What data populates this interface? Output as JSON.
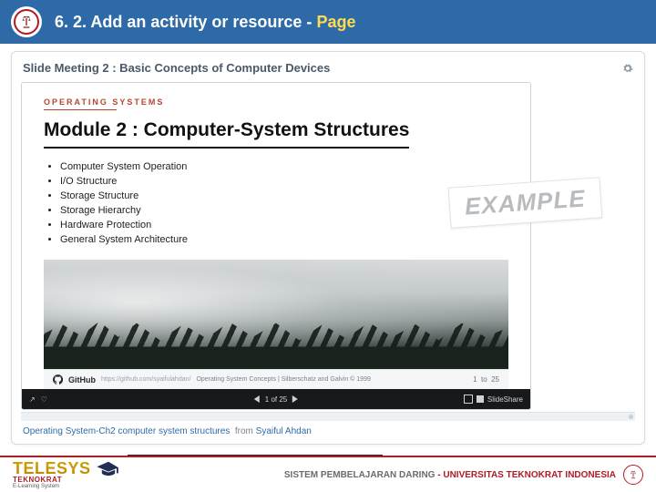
{
  "header": {
    "title_pre": "6. 2. Add an activity or resource - ",
    "title_em": "Page"
  },
  "card": {
    "title": "Slide Meeting 2 : Basic Concepts of Computer Devices"
  },
  "slide": {
    "kicker": "OPERATING SYSTEMS",
    "module_title": "Module 2 : Computer-System Structures",
    "bullets": [
      "Computer System Operation",
      "I/O Structure",
      "Storage Structure",
      "Storage Hierarchy",
      "Hardware Protection",
      "General System Architecture"
    ],
    "footer": {
      "gh_word": "GitHub",
      "url": "https://github.com/syaifulahdan/",
      "source": "Operating System Concepts | Silberschatz and Galvin © 1999",
      "page_from": "1",
      "page_to": "to",
      "page_total": "25"
    }
  },
  "ssbar": {
    "center": "1 of 25",
    "brand": "SlideShare"
  },
  "attribution": {
    "title": "Operating System-Ch2 computer system structures",
    "from": "from",
    "author": "Syaiful Ahdan"
  },
  "watermark": "EXAMPLE",
  "footer": {
    "brand_main": "TELESYS",
    "brand_sub": "TEKNOKRAT",
    "brand_sub2": "E-Learning System",
    "text_grey": "SISTEM PEMBELAJARAN DARING",
    "text_dash": " - ",
    "text_red": "UNIVERSITAS TEKNOKRAT INDONESIA"
  }
}
